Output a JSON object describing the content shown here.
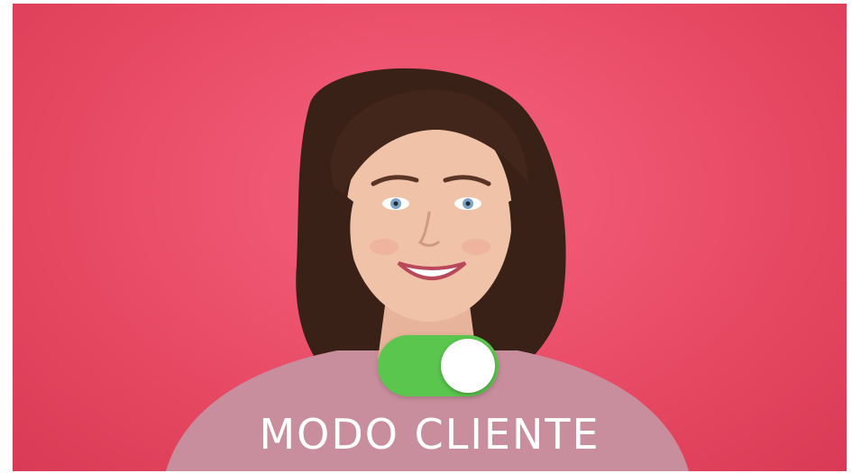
{
  "caption": {
    "text": "MODO CLIENTE"
  },
  "toggle": {
    "state": "on",
    "on_color": "#5ac64d",
    "knob_color": "#ffffff"
  },
  "photo": {
    "background_color": "#ee546f",
    "icon": "portrait-photo"
  }
}
